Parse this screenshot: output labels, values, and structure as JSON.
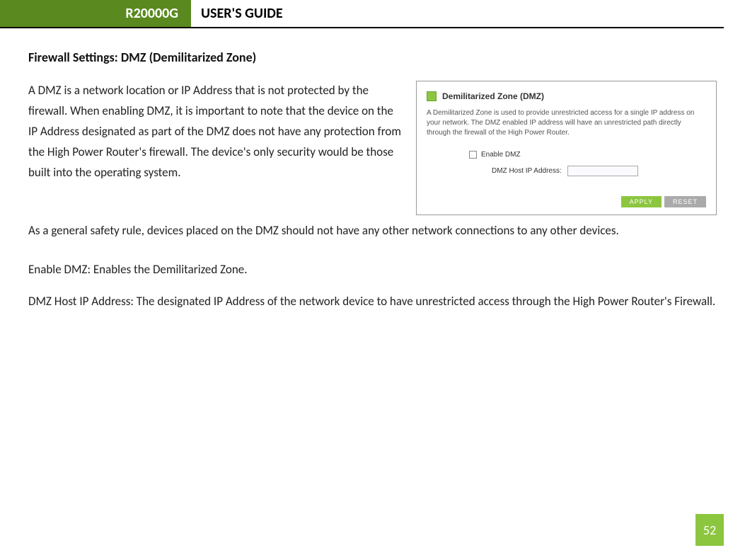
{
  "header": {
    "model": "R20000G",
    "title": "USER'S GUIDE"
  },
  "section_title": "Firewall Settings: DMZ (Demilitarized Zone)",
  "para1": "A DMZ is a network location or IP Address that is not protected by the firewall.  When enabling DMZ,  it is important to note that the device on the IP Address designated as part of the DMZ does not have any protection from the High Power Router's firewall.  The device's only security would be those built into the operating system.",
  "para2": "As a general safety rule, devices placed on the DMZ should not have any other network connections to any other devices.",
  "para3": "Enable DMZ: Enables the Demilitarized Zone.",
  "para4": "DMZ Host IP Address:  The designated IP Address of the network device to have unrestricted access through the High Power Router's Firewall.",
  "screenshot": {
    "title": "Demilitarized Zone (DMZ)",
    "description": "A Demilitarized Zone is used to provide unrestricted access for a single IP address on your network. The DMZ enabled IP address will have an unrestricted path directly through the firewall of the High Power Router.",
    "enable_label": "Enable DMZ",
    "host_label": "DMZ Host IP Address:",
    "apply": "APPLY",
    "reset": "RESET"
  },
  "page_number": "52"
}
